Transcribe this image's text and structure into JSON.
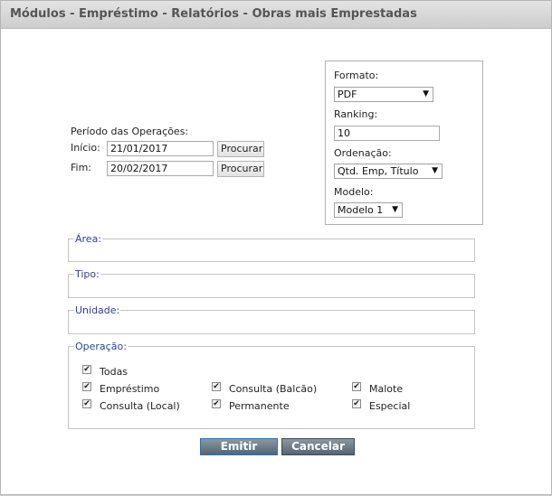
{
  "title": "Módulos - Empréstimo - Relatórios - Obras mais Emprestadas",
  "periodo": {
    "label": "Período das Operações:",
    "inicio_label": "Início:",
    "inicio_value": "21/01/2017",
    "fim_label": "Fim:",
    "fim_value": "20/02/2017",
    "procurar_label": "Procurar"
  },
  "options": {
    "formato_label": "Formato:",
    "formato_value": "PDF",
    "ranking_label": "Ranking:",
    "ranking_value": "10",
    "ordenacao_label": "Ordenação:",
    "ordenacao_value": "Qtd. Emp, Título",
    "modelo_label": "Modelo:",
    "modelo_value": "Modelo 1"
  },
  "groups": {
    "area": "Área:",
    "tipo": "Tipo:",
    "unidade": "Unidade:",
    "operacao": "Operação:"
  },
  "operacao_items": {
    "todas": "Todas",
    "emprestimo": "Empréstimo",
    "consulta_balcao": "Consulta (Balcão)",
    "malote": "Malote",
    "consulta_local": "Consulta (Local)",
    "permanente": "Permanente",
    "especial": "Especial"
  },
  "actions": {
    "emitir": "Emitir",
    "cancelar": "Cancelar"
  },
  "icons": {
    "dropdown": "chevron-down-icon",
    "checkbox": "checkmark-icon"
  }
}
